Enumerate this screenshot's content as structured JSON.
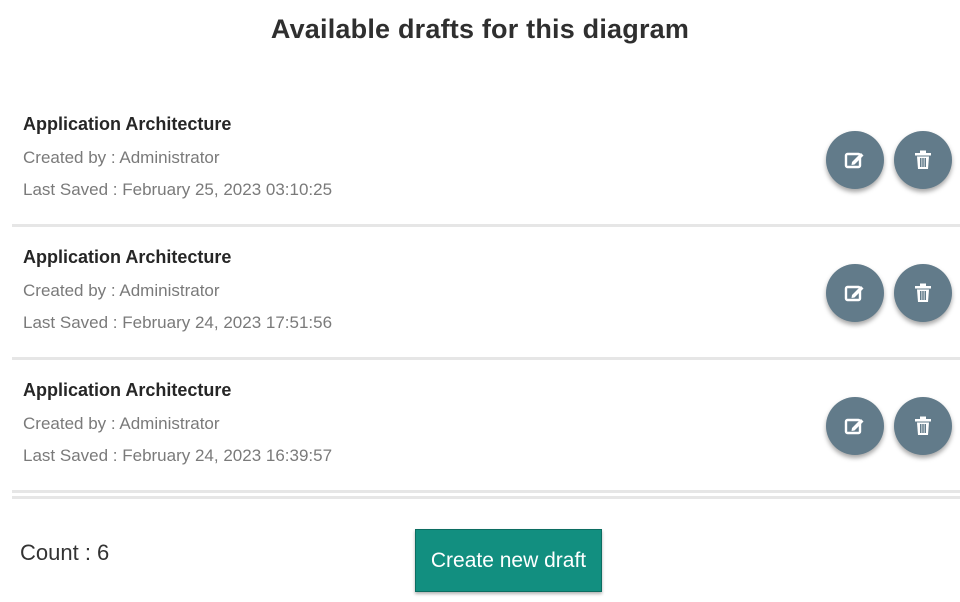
{
  "header": {
    "title": "Available drafts for this diagram"
  },
  "drafts": [
    {
      "name": "Application Architecture",
      "created_by": "Created by : Administrator",
      "last_saved": "Last Saved : February 25, 2023 03:10:25"
    },
    {
      "name": "Application Architecture",
      "created_by": "Created by : Administrator",
      "last_saved": "Last Saved : February 24, 2023 17:51:56"
    },
    {
      "name": "Application Architecture",
      "created_by": "Created by : Administrator",
      "last_saved": "Last Saved : February 24, 2023 16:39:57"
    }
  ],
  "icons": {
    "edit": "edit-icon",
    "delete": "trash-icon"
  },
  "footer": {
    "count": "Count : 6",
    "create_label": "Create new draft"
  },
  "colors": {
    "round_button": "#627b8a",
    "primary_button": "#128f80"
  }
}
